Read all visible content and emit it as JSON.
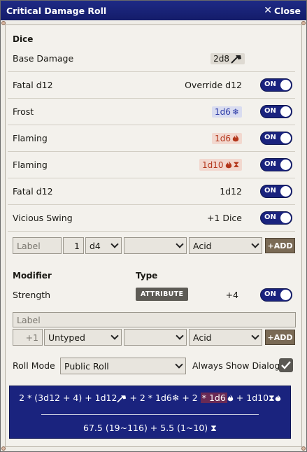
{
  "window": {
    "title": "Critical Damage Roll",
    "close_label": "Close"
  },
  "dice": {
    "heading": "Dice",
    "base_damage": {
      "label": "Base Damage",
      "value": "2d8"
    },
    "rows": [
      {
        "label": "Fatal d12",
        "value": "Override d12",
        "toggle": "ON"
      },
      {
        "label": "Frost",
        "value": "1d6",
        "toggle": "ON"
      },
      {
        "label": "Flaming",
        "value": "1d6",
        "toggle": "ON"
      },
      {
        "label": "Flaming",
        "value": "1d10",
        "toggle": "ON"
      },
      {
        "label": "Fatal d12",
        "value": "1d12",
        "toggle": "ON"
      },
      {
        "label": "Vicious Swing",
        "value": "+1 Dice",
        "toggle": "ON"
      }
    ],
    "add_row": {
      "label_placeholder": "Label",
      "count": "1",
      "die": "d4",
      "category": "",
      "damage_type": "Acid",
      "add_label": "+ADD"
    }
  },
  "modifier": {
    "heading": "Modifier",
    "type_heading": "Type",
    "strength": {
      "label": "Strength",
      "type": "ATTRIBUTE",
      "value": "+4",
      "toggle": "ON"
    },
    "add_row": {
      "label_placeholder": "Label",
      "value_placeholder": "+1",
      "modifier_type": "Untyped",
      "category": "",
      "damage_type": "Acid",
      "add_label": "+ADD"
    }
  },
  "roll": {
    "mode_label": "Roll Mode",
    "mode_value": "Public Roll",
    "dialog_label": "Always Show Dialog",
    "dialog_checked": true
  },
  "formula": {
    "p1": "2 * (3d12 + 4) + 1d12",
    "p2": "+ 2 * 1d6",
    "p3": "+ 2",
    "p4": "* 1d6",
    "p5": "+ 1d10",
    "result": "67.5 (19~116) + 5.5 (1~10)"
  },
  "colors": {
    "accent": "#1a237e",
    "add_button": "#7a6a55",
    "frost": "#2b3aa6",
    "fire": "#b3361b"
  }
}
